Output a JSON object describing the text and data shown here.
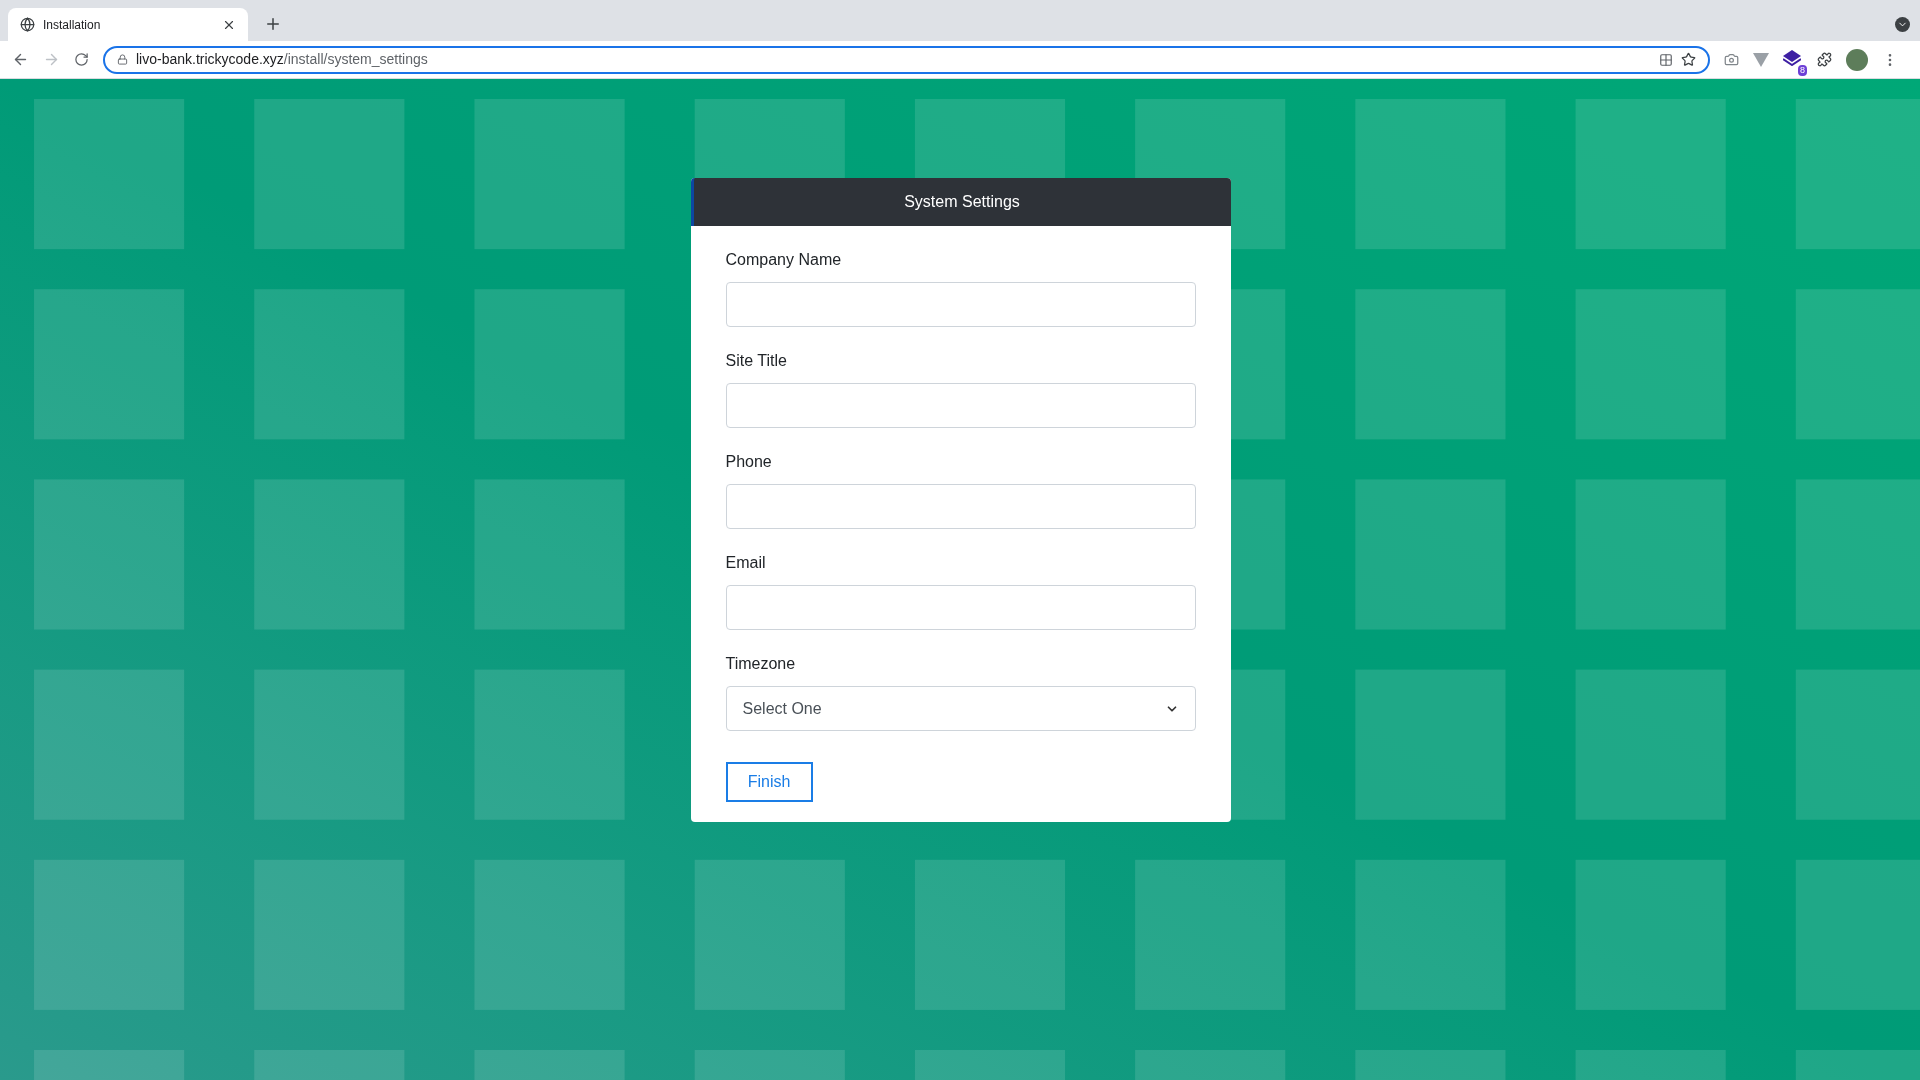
{
  "browser": {
    "tab": {
      "title": "Installation",
      "selected": true
    },
    "url": {
      "host": "livo-bank.trickycode.xyz",
      "path": "/install/system_settings"
    },
    "extension_badge": "8"
  },
  "form": {
    "title": "System Settings",
    "fields": [
      {
        "kind": "text",
        "label": "Company Name"
      },
      {
        "kind": "text",
        "label": "Site Title"
      },
      {
        "kind": "text",
        "label": "Phone"
      },
      {
        "kind": "text",
        "label": "Email"
      },
      {
        "kind": "select",
        "label": "Timezone",
        "value": "Select One"
      }
    ],
    "button": "Finish"
  }
}
